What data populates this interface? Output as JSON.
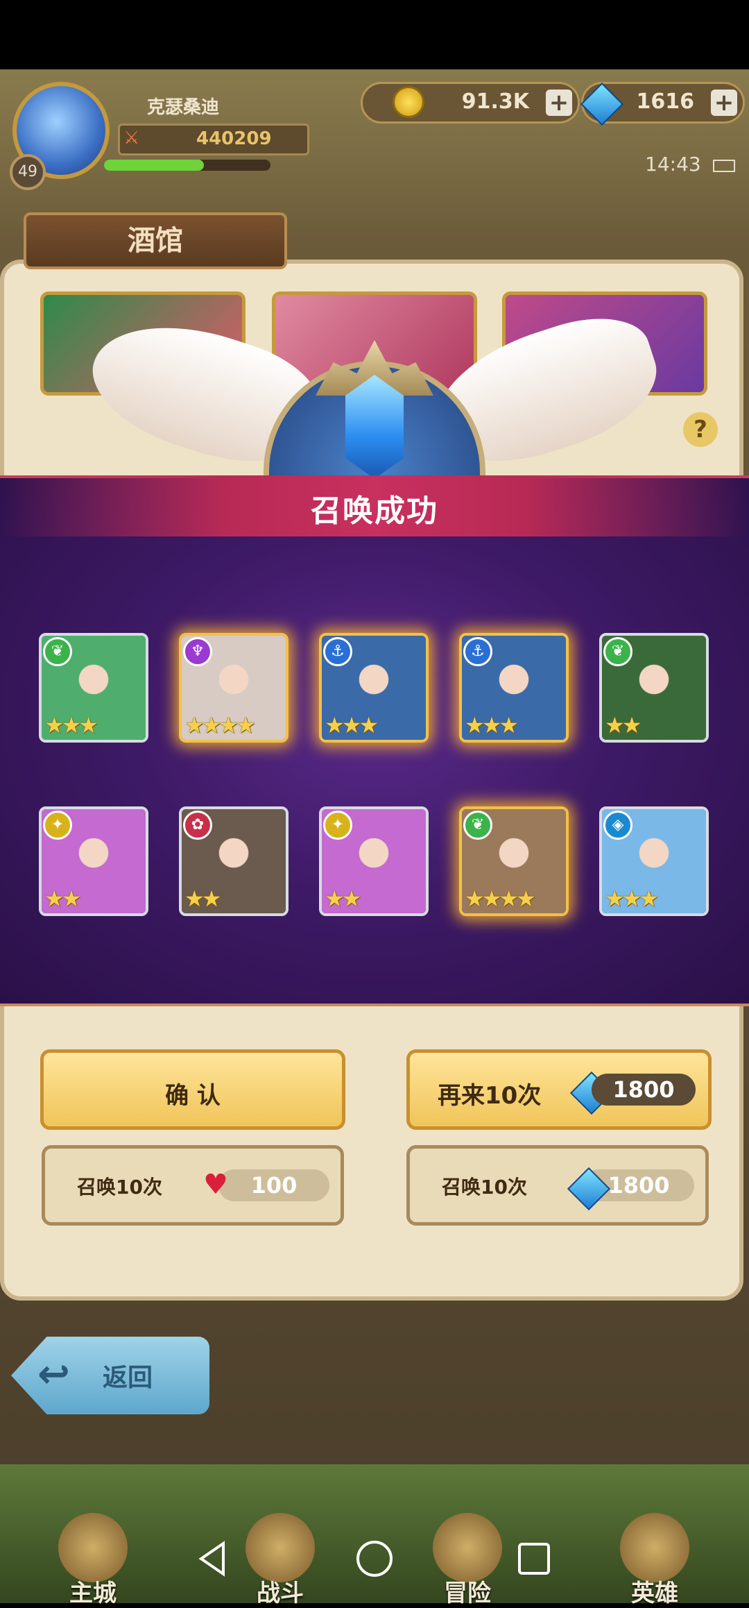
{
  "player": {
    "name": "克瑟桑迪",
    "level": "49",
    "power": "440209",
    "xp_fraction": 0.6
  },
  "currency": {
    "gold": "91.3K",
    "gems": "1616"
  },
  "status": {
    "time": "14:43"
  },
  "tavern": {
    "title": "酒馆"
  },
  "dialog": {
    "title": "召唤成功",
    "heroes": [
      {
        "faction": "nature",
        "faction_glyph": "❦",
        "emblem_color": "#3bb34a",
        "stars": 3,
        "rare": false,
        "portrait": "blonde-elf-girl",
        "bg": "#4fae6e"
      },
      {
        "faction": "shadow",
        "faction_glyph": "♆",
        "emblem_color": "#9a3ad0",
        "stars": 4,
        "rare": true,
        "portrait": "white-hair-girl",
        "bg": "#d7cbc4"
      },
      {
        "faction": "ocean",
        "faction_glyph": "⚓",
        "emblem_color": "#2a6fd4",
        "stars": 3,
        "rare": true,
        "portrait": "blindfold-blue-hair",
        "bg": "#3a6aa8"
      },
      {
        "faction": "ocean",
        "faction_glyph": "⚓",
        "emblem_color": "#2a6fd4",
        "stars": 3,
        "rare": true,
        "portrait": "blindfold-blue-hair",
        "bg": "#3a6aa8"
      },
      {
        "faction": "nature",
        "faction_glyph": "❦",
        "emblem_color": "#3bb34a",
        "stars": 2,
        "rare": false,
        "portrait": "owl-knight",
        "bg": "#3b6a3a"
      },
      {
        "faction": "light",
        "faction_glyph": "✦",
        "emblem_color": "#d8b21a",
        "stars": 2,
        "rare": false,
        "portrait": "pink-witch",
        "bg": "#c46ad0"
      },
      {
        "faction": "fire",
        "faction_glyph": "✿",
        "emblem_color": "#c8304a",
        "stars": 2,
        "rare": false,
        "portrait": "stone-golem",
        "bg": "#6b5a4e"
      },
      {
        "faction": "light",
        "faction_glyph": "✦",
        "emblem_color": "#d8b21a",
        "stars": 2,
        "rare": false,
        "portrait": "pink-witch",
        "bg": "#c46ad0"
      },
      {
        "faction": "nature",
        "faction_glyph": "❦",
        "emblem_color": "#3bb34a",
        "stars": 4,
        "rare": true,
        "portrait": "bearded-warrior",
        "bg": "#9a7a5a"
      },
      {
        "faction": "water",
        "faction_glyph": "◈",
        "emblem_color": "#1a8ad0",
        "stars": 3,
        "rare": false,
        "portrait": "blue-hood-mouse",
        "bg": "#7ab8e8"
      }
    ]
  },
  "buttons": {
    "confirm": "确 认",
    "again": "再来10次",
    "again_cost": "1800",
    "summon_left_label": "召唤10次",
    "summon_left_cost": "100",
    "summon_right_label": "召唤10次",
    "summon_right_cost": "1800",
    "back": "返回"
  },
  "nav": {
    "tabs": [
      "主城",
      "战斗",
      "冒险",
      "英雄"
    ]
  },
  "colors": {
    "overlay": "#3e1a66",
    "title_band": "#c8305e",
    "gold_border": "#f2c14a",
    "button_gold": "#f0c55a"
  }
}
